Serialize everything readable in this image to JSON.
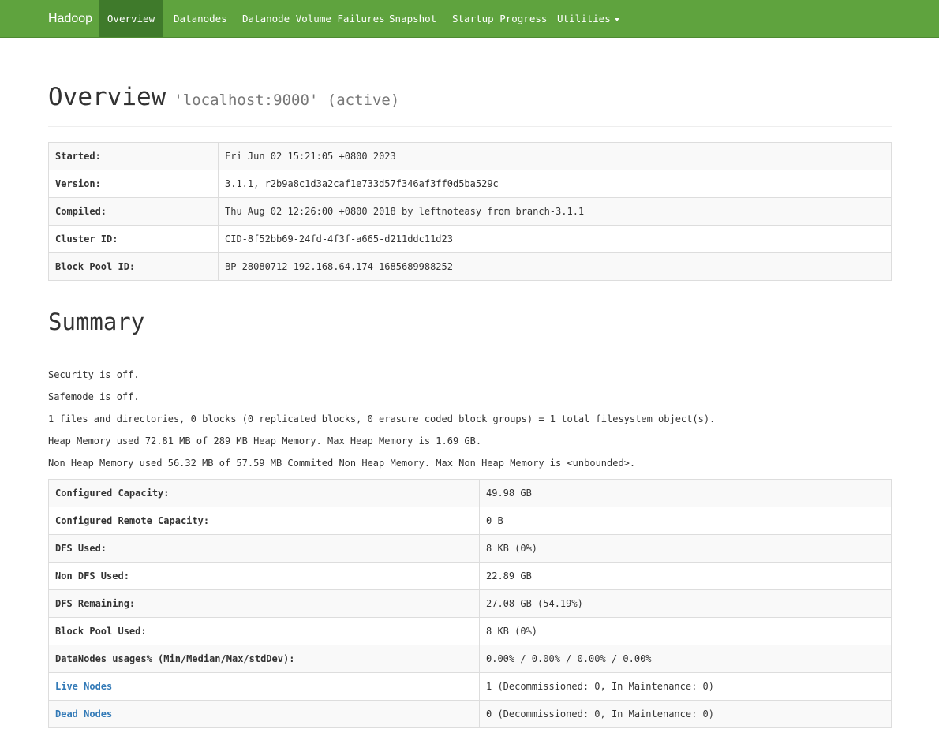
{
  "nav": {
    "brand": "Hadoop",
    "items": [
      {
        "label": "Overview"
      },
      {
        "label": "Datanodes"
      },
      {
        "label": "Datanode Volume Failures"
      },
      {
        "label": "Snapshot"
      },
      {
        "label": "Startup Progress"
      },
      {
        "label": "Utilities"
      }
    ]
  },
  "overview": {
    "title": "Overview",
    "subtitle": "'localhost:9000' (active)",
    "rows": [
      {
        "label": "Started:",
        "value": "Fri Jun 02 15:21:05 +0800 2023"
      },
      {
        "label": "Version:",
        "value": "3.1.1, r2b9a8c1d3a2caf1e733d57f346af3ff0d5ba529c"
      },
      {
        "label": "Compiled:",
        "value": "Thu Aug 02 12:26:00 +0800 2018 by leftnoteasy from branch-3.1.1"
      },
      {
        "label": "Cluster ID:",
        "value": "CID-8f52bb69-24fd-4f3f-a665-d211ddc11d23"
      },
      {
        "label": "Block Pool ID:",
        "value": "BP-28080712-192.168.64.174-1685689988252"
      }
    ]
  },
  "summary": {
    "title": "Summary",
    "lines": [
      "Security is off.",
      "Safemode is off.",
      "1 files and directories, 0 blocks (0 replicated blocks, 0 erasure coded block groups) = 1 total filesystem object(s).",
      "Heap Memory used 72.81 MB of 289 MB Heap Memory. Max Heap Memory is 1.69 GB.",
      "Non Heap Memory used 56.32 MB of 57.59 MB Commited Non Heap Memory. Max Non Heap Memory is <unbounded>."
    ],
    "rows": [
      {
        "label": "Configured Capacity:",
        "value": "49.98 GB"
      },
      {
        "label": "Configured Remote Capacity:",
        "value": "0 B"
      },
      {
        "label": "DFS Used:",
        "value": "8 KB (0%)"
      },
      {
        "label": "Non DFS Used:",
        "value": "22.89 GB"
      },
      {
        "label": "DFS Remaining:",
        "value": "27.08 GB (54.19%)"
      },
      {
        "label": "Block Pool Used:",
        "value": "8 KB (0%)"
      },
      {
        "label": "DataNodes usages% (Min/Median/Max/stdDev):",
        "value": "0.00% / 0.00% / 0.00% / 0.00%"
      },
      {
        "label": "Live Nodes",
        "value": "1 (Decommissioned: 0, In Maintenance: 0)"
      },
      {
        "label": "Dead Nodes",
        "value": "0 (Decommissioned: 0, In Maintenance: 0)"
      }
    ]
  },
  "colors": {
    "navbar": "#5fa33e",
    "navbar_active": "#3f7a2b",
    "link": "#337ab7"
  }
}
